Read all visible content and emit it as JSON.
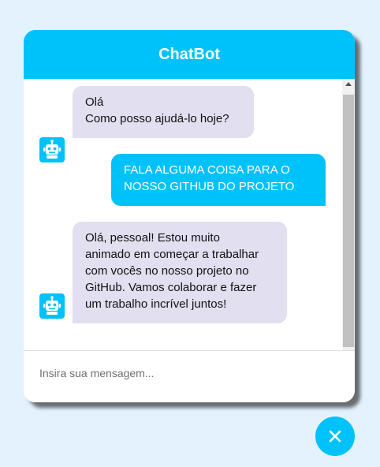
{
  "header": {
    "title": "ChatBot"
  },
  "messages": [
    {
      "type": "incoming",
      "text": "Olá\nComo posso ajudá-lo hoje?"
    },
    {
      "type": "outgoing",
      "text": "FALA ALGUMA COISA PARA O\nNOSSO GITHUB DO PROJETO"
    },
    {
      "type": "incoming",
      "text": "Olá, pessoal! Estou muito\nanimado em começar a trabalhar\ncom vocês no nosso projeto no\nGitHub. Vamos colaborar e fazer\num trabalho incrível juntos!"
    }
  ],
  "input": {
    "placeholder": "Insira sua mensagem...",
    "value": ""
  },
  "icons": {
    "bot": "robot-icon",
    "close": "close-icon"
  },
  "colors": {
    "accent": "#00c2fa",
    "incoming_bubble": "#e1dff0",
    "page_background": "#e3f2fd"
  }
}
